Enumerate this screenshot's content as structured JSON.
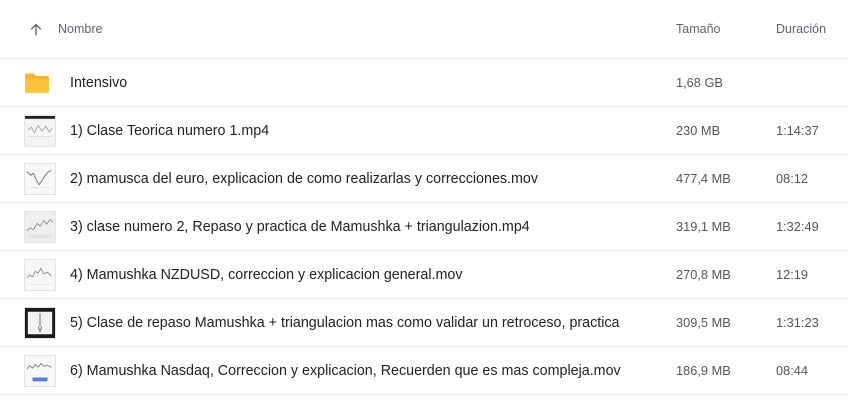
{
  "header": {
    "name_label": "Nombre",
    "size_label": "Tamaño",
    "duration_label": "Duración",
    "sort_icon": "arrow-up-icon"
  },
  "rows": [
    {
      "name": "Intensivo",
      "size": "1,68 GB",
      "duration": "",
      "icon": "folder-icon",
      "icon_color": "#f9a825"
    },
    {
      "name": "1) Clase Teorica numero 1.mp4",
      "size": "230 MB",
      "duration": "1:14:37",
      "icon": "video-thumbnail-icon"
    },
    {
      "name": "2) mamusca del euro, explicacion de como realizarlas y correcciones.mov",
      "size": "477,4 MB",
      "duration": "08:12",
      "icon": "video-thumbnail-icon"
    },
    {
      "name": "3) clase numero 2, Repaso y practica de Mamushka + triangulazion.mp4",
      "size": "319,1 MB",
      "duration": "1:32:49",
      "icon": "video-thumbnail-icon"
    },
    {
      "name": "4) Mamushka NZDUSD, correccion y explicacion general.mov",
      "size": "270,8 MB",
      "duration": "12:19",
      "icon": "video-thumbnail-icon"
    },
    {
      "name": "5) Clase de repaso Mamushka + triangulacion mas como validar un retroceso, practica",
      "size": "309,5 MB",
      "duration": "1:31:23",
      "icon": "video-thumbnail-icon"
    },
    {
      "name": "6) Mamushka Nasdaq, Correccion y explicacion, Recuerden que es mas compleja.mov",
      "size": "186,9 MB",
      "duration": "08:44",
      "icon": "video-thumbnail-icon"
    }
  ]
}
